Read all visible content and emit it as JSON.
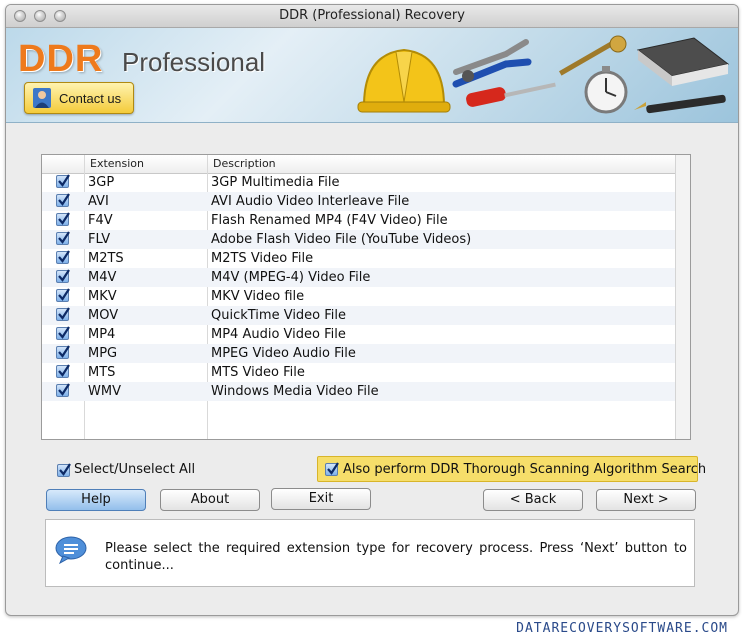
{
  "window": {
    "title": "DDR (Professional) Recovery"
  },
  "banner": {
    "logo_main": "DDR",
    "logo_sub": "Professional",
    "contact_label": "Contact us"
  },
  "table": {
    "headers": {
      "extension": "Extension",
      "description": "Description"
    },
    "rows": [
      {
        "ext": "3GP",
        "desc": "3GP Multimedia File",
        "checked": true
      },
      {
        "ext": "AVI",
        "desc": "AVI Audio Video Interleave File",
        "checked": true
      },
      {
        "ext": "F4V",
        "desc": "Flash Renamed MP4 (F4V Video) File",
        "checked": true
      },
      {
        "ext": "FLV",
        "desc": "Adobe Flash Video File (YouTube Videos)",
        "checked": true
      },
      {
        "ext": "M2TS",
        "desc": "M2TS Video File",
        "checked": true
      },
      {
        "ext": "M4V",
        "desc": "M4V (MPEG-4) Video File",
        "checked": true
      },
      {
        "ext": "MKV",
        "desc": "MKV Video file",
        "checked": true
      },
      {
        "ext": "MOV",
        "desc": "QuickTime Video File",
        "checked": true
      },
      {
        "ext": "MP4",
        "desc": "MP4 Audio Video File",
        "checked": true
      },
      {
        "ext": "MPG",
        "desc": "MPEG Video Audio File",
        "checked": true
      },
      {
        "ext": "MTS",
        "desc": "MTS Video File",
        "checked": true
      },
      {
        "ext": "WMV",
        "desc": "Windows Media Video File",
        "checked": true
      }
    ]
  },
  "options": {
    "select_all_label": "Select/Unselect All",
    "select_all_checked": true,
    "thorough_label": "Also perform DDR Thorough Scanning Algorithm Search",
    "thorough_checked": true
  },
  "buttons": {
    "help": "Help",
    "about": "About",
    "exit": "Exit",
    "back": "< Back",
    "next": "Next >"
  },
  "info": {
    "message": "Please select the required extension type for recovery process. Press ‘Next’ button to continue..."
  },
  "footer": {
    "site": "DATARECOVERYSOFTWARE.COM"
  },
  "colors": {
    "logo_orange": "#ee7a1c",
    "highlight_yellow": "#f6de6a",
    "checkbox_blue": "#7fb1ea"
  }
}
